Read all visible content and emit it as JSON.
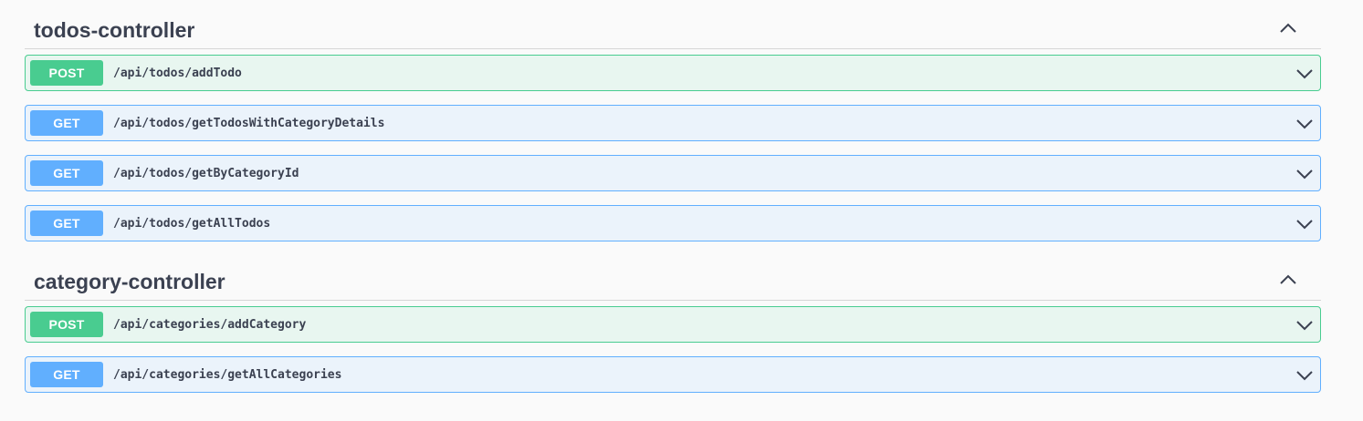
{
  "sections": [
    {
      "title": "todos-controller",
      "operations": [
        {
          "method": "POST",
          "path": "/api/todos/addTodo"
        },
        {
          "method": "GET",
          "path": "/api/todos/getTodosWithCategoryDetails"
        },
        {
          "method": "GET",
          "path": "/api/todos/getByCategoryId"
        },
        {
          "method": "GET",
          "path": "/api/todos/getAllTodos"
        }
      ]
    },
    {
      "title": "category-controller",
      "operations": [
        {
          "method": "POST",
          "path": "/api/categories/addCategory"
        },
        {
          "method": "GET",
          "path": "/api/categories/getAllCategories"
        }
      ]
    }
  ],
  "icons": {
    "collapse": "chevron-up-icon",
    "expand": "chevron-down-icon"
  },
  "colors": {
    "post": "#49cc90",
    "post_bg": "#e8f6f0",
    "get": "#61affe",
    "get_bg": "#ebf3fb",
    "text": "#3b4151"
  }
}
